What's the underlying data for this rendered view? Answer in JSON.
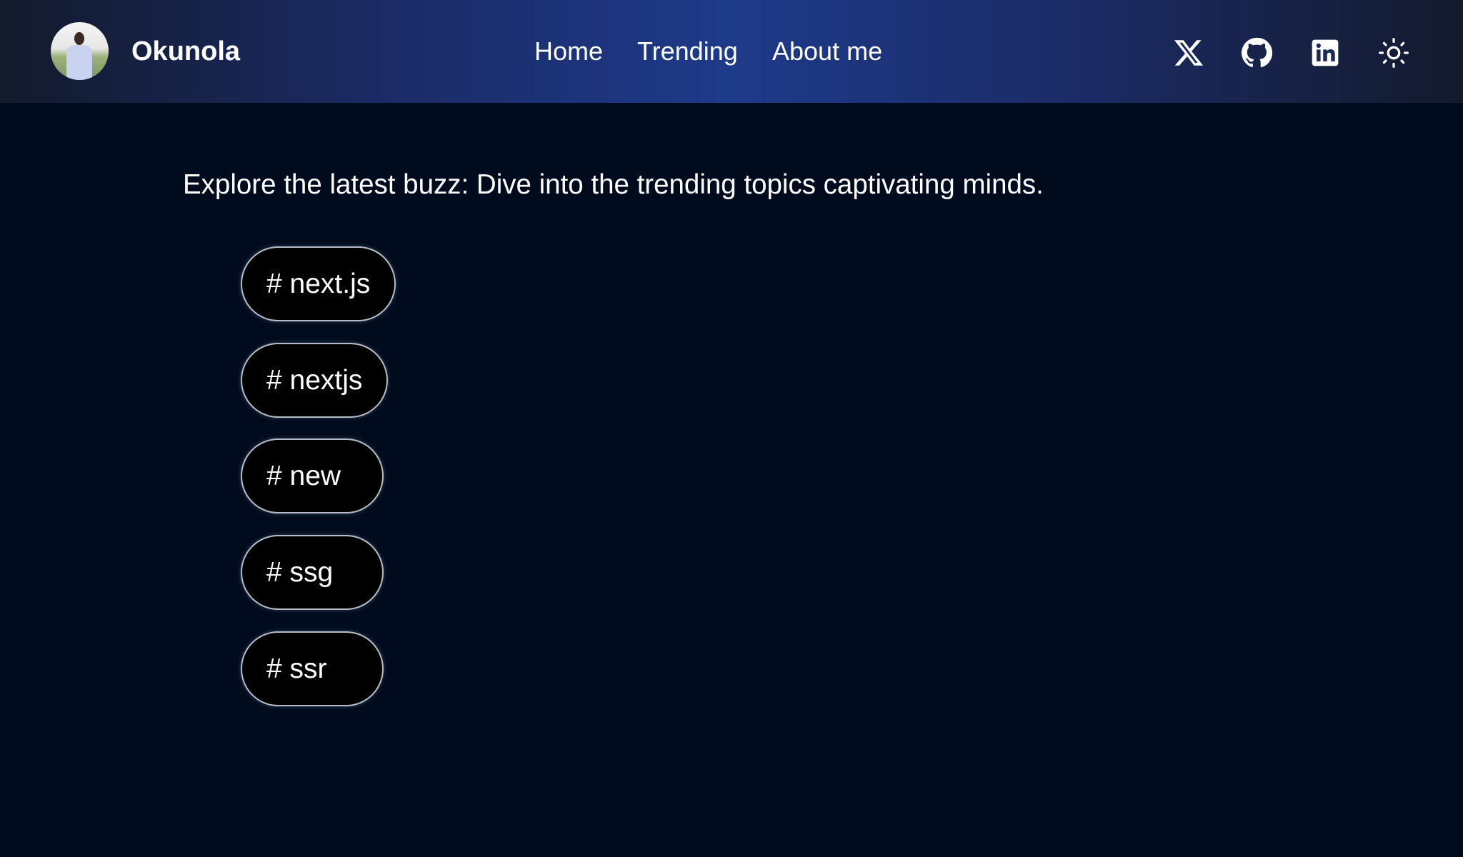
{
  "header": {
    "brand": "Okunola",
    "nav": [
      {
        "label": "Home"
      },
      {
        "label": "Trending"
      },
      {
        "label": "About me"
      }
    ],
    "icons": [
      "x-twitter-icon",
      "github-icon",
      "linkedin-icon",
      "sun-icon"
    ]
  },
  "main": {
    "intro": "Explore the latest buzz: Dive into the trending topics captivating minds.",
    "tags": [
      {
        "label": "# next.js"
      },
      {
        "label": "# nextjs"
      },
      {
        "label": "# new"
      },
      {
        "label": "# ssg"
      },
      {
        "label": "# ssr"
      }
    ]
  },
  "colors": {
    "background": "#000c1e",
    "header_center": "#1e3a8a",
    "pill_bg": "#000000"
  }
}
